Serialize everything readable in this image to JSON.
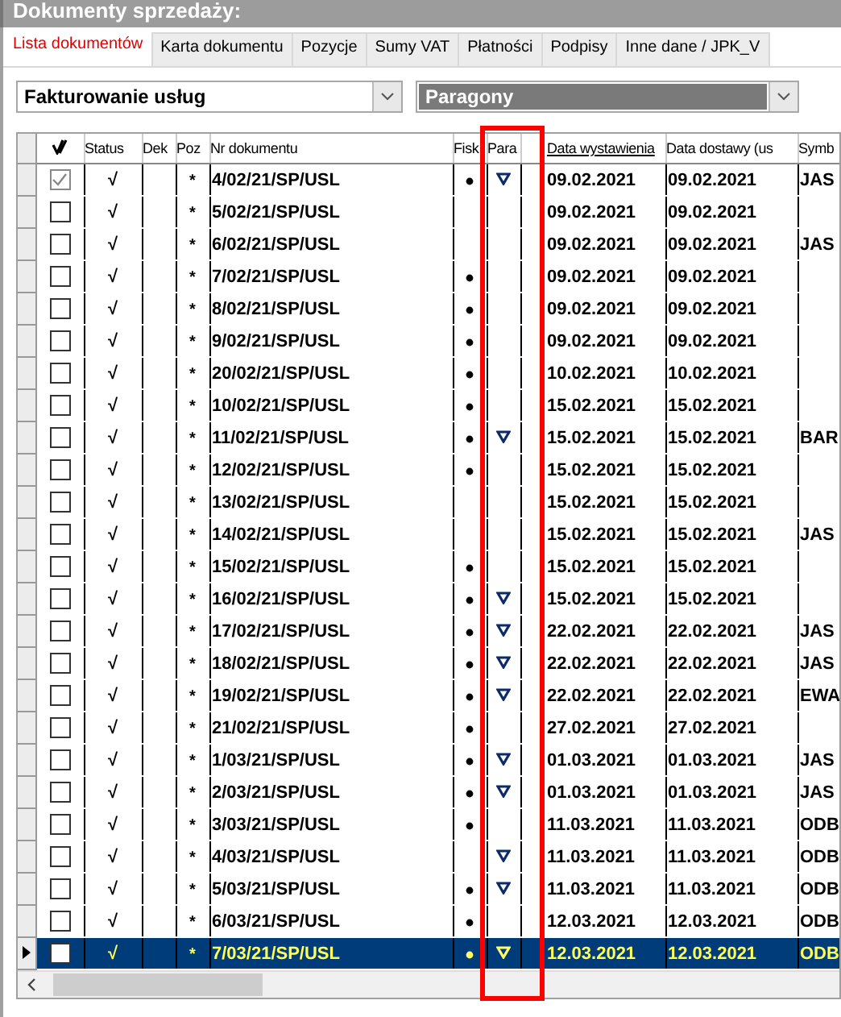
{
  "window": {
    "title": "Dokumenty sprzedaży:"
  },
  "tabs": [
    {
      "label": "Lista dokumentów",
      "selected": true
    },
    {
      "label": "Karta dokumentu",
      "selected": false
    },
    {
      "label": "Pozycje",
      "selected": false
    },
    {
      "label": "Sumy VAT",
      "selected": false
    },
    {
      "label": "Płatności",
      "selected": false
    },
    {
      "label": "Podpisy",
      "selected": false
    },
    {
      "label": "Inne dane / JPK_V",
      "selected": false
    }
  ],
  "filters": [
    {
      "value": "Fakturowanie usług",
      "highlighted": false
    },
    {
      "value": "Paragony",
      "highlighted": true
    }
  ],
  "table": {
    "columns": [
      {
        "kind": "check"
      },
      {
        "kind": "text",
        "label": "Status",
        "sorted": false
      },
      {
        "kind": "text",
        "label": "Dek",
        "sorted": false
      },
      {
        "kind": "text",
        "label": "Poz",
        "sorted": false
      },
      {
        "kind": "text",
        "label": "Nr dokumentu",
        "sorted": false
      },
      {
        "kind": "text",
        "label": "Fisk",
        "sorted": false
      },
      {
        "kind": "text",
        "label": "Para",
        "sorted": false
      },
      {
        "kind": "text",
        "label": "Data wystawienia",
        "sorted": true
      },
      {
        "kind": "text",
        "label": "Data dostawy (us",
        "sorted": false
      },
      {
        "kind": "text",
        "label": "Symb",
        "sorted": false
      }
    ],
    "rows": [
      {
        "checked": true,
        "status": "√",
        "poz": "*",
        "number": "4/02/21/SP/USL",
        "fiscal": true,
        "receipt": true,
        "issued": "09.02.2021",
        "delivered": "09.02.2021",
        "symbol": "JAS",
        "selected": false
      },
      {
        "checked": false,
        "status": "√",
        "poz": "*",
        "number": "5/02/21/SP/USL",
        "fiscal": false,
        "receipt": false,
        "issued": "09.02.2021",
        "delivered": "09.02.2021",
        "selected": false
      },
      {
        "checked": false,
        "status": "√",
        "poz": "*",
        "number": "6/02/21/SP/USL",
        "fiscal": false,
        "receipt": false,
        "issued": "09.02.2021",
        "delivered": "09.02.2021",
        "symbol": "JAS",
        "selected": false
      },
      {
        "checked": false,
        "status": "√",
        "poz": "*",
        "number": "7/02/21/SP/USL",
        "fiscal": true,
        "receipt": false,
        "issued": "09.02.2021",
        "delivered": "09.02.2021",
        "selected": false
      },
      {
        "checked": false,
        "status": "√",
        "poz": "*",
        "number": "8/02/21/SP/USL",
        "fiscal": true,
        "receipt": false,
        "issued": "09.02.2021",
        "delivered": "09.02.2021",
        "selected": false
      },
      {
        "checked": false,
        "status": "√",
        "poz": "*",
        "number": "9/02/21/SP/USL",
        "fiscal": true,
        "receipt": false,
        "issued": "09.02.2021",
        "delivered": "09.02.2021",
        "selected": false
      },
      {
        "checked": false,
        "status": "√",
        "poz": "*",
        "number": "20/02/21/SP/USL",
        "fiscal": true,
        "receipt": false,
        "issued": "10.02.2021",
        "delivered": "10.02.2021",
        "selected": false
      },
      {
        "checked": false,
        "status": "√",
        "poz": "*",
        "number": "10/02/21/SP/USL",
        "fiscal": true,
        "receipt": false,
        "issued": "15.02.2021",
        "delivered": "15.02.2021",
        "selected": false
      },
      {
        "checked": false,
        "status": "√",
        "poz": "*",
        "number": "11/02/21/SP/USL",
        "fiscal": true,
        "receipt": true,
        "issued": "15.02.2021",
        "delivered": "15.02.2021",
        "symbol": "BAR",
        "selected": false
      },
      {
        "checked": false,
        "status": "√",
        "poz": "*",
        "number": "12/02/21/SP/USL",
        "fiscal": true,
        "receipt": false,
        "issued": "15.02.2021",
        "delivered": "15.02.2021",
        "selected": false
      },
      {
        "checked": false,
        "status": "√",
        "poz": "*",
        "number": "13/02/21/SP/USL",
        "fiscal": false,
        "receipt": false,
        "issued": "15.02.2021",
        "delivered": "15.02.2021",
        "selected": false
      },
      {
        "checked": false,
        "status": "√",
        "poz": "*",
        "number": "14/02/21/SP/USL",
        "fiscal": false,
        "receipt": false,
        "issued": "15.02.2021",
        "delivered": "15.02.2021",
        "symbol": "JAS",
        "selected": false
      },
      {
        "checked": false,
        "status": "√",
        "poz": "*",
        "number": "15/02/21/SP/USL",
        "fiscal": true,
        "receipt": false,
        "issued": "15.02.2021",
        "delivered": "15.02.2021",
        "selected": false
      },
      {
        "checked": false,
        "status": "√",
        "poz": "*",
        "number": "16/02/21/SP/USL",
        "fiscal": true,
        "receipt": true,
        "issued": "15.02.2021",
        "delivered": "15.02.2021",
        "selected": false
      },
      {
        "checked": false,
        "status": "√",
        "poz": "*",
        "number": "17/02/21/SP/USL",
        "fiscal": true,
        "receipt": true,
        "issued": "22.02.2021",
        "delivered": "22.02.2021",
        "symbol": "JAS",
        "selected": false
      },
      {
        "checked": false,
        "status": "√",
        "poz": "*",
        "number": "18/02/21/SP/USL",
        "fiscal": true,
        "receipt": true,
        "issued": "22.02.2021",
        "delivered": "22.02.2021",
        "symbol": "JAS",
        "selected": false
      },
      {
        "checked": false,
        "status": "√",
        "poz": "*",
        "number": "19/02/21/SP/USL",
        "fiscal": true,
        "receipt": true,
        "issued": "22.02.2021",
        "delivered": "22.02.2021",
        "symbol": "EWA",
        "selected": false
      },
      {
        "checked": false,
        "status": "√",
        "poz": "*",
        "number": "21/02/21/SP/USL",
        "fiscal": true,
        "receipt": false,
        "issued": "27.02.2021",
        "delivered": "27.02.2021",
        "selected": false
      },
      {
        "checked": false,
        "status": "√",
        "poz": "*",
        "number": "1/03/21/SP/USL",
        "fiscal": true,
        "receipt": true,
        "issued": "01.03.2021",
        "delivered": "01.03.2021",
        "symbol": "JAS",
        "selected": false
      },
      {
        "checked": false,
        "status": "√",
        "poz": "*",
        "number": "2/03/21/SP/USL",
        "fiscal": true,
        "receipt": true,
        "issued": "01.03.2021",
        "delivered": "01.03.2021",
        "symbol": "JAS",
        "selected": false
      },
      {
        "checked": false,
        "status": "√",
        "poz": "*",
        "number": "3/03/21/SP/USL",
        "fiscal": true,
        "receipt": false,
        "issued": "11.03.2021",
        "delivered": "11.03.2021",
        "symbol": "ODB",
        "selected": false
      },
      {
        "checked": false,
        "status": "√",
        "poz": "*",
        "number": "4/03/21/SP/USL",
        "fiscal": false,
        "receipt": true,
        "issued": "11.03.2021",
        "delivered": "11.03.2021",
        "symbol": "ODB",
        "selected": false
      },
      {
        "checked": false,
        "status": "√",
        "poz": "*",
        "number": "5/03/21/SP/USL",
        "fiscal": true,
        "receipt": true,
        "issued": "11.03.2021",
        "delivered": "11.03.2021",
        "symbol": "ODB",
        "selected": false
      },
      {
        "checked": false,
        "status": "√",
        "poz": "*",
        "number": "6/03/21/SP/USL",
        "fiscal": true,
        "receipt": false,
        "issued": "12.03.2021",
        "delivered": "12.03.2021",
        "symbol": "ODB",
        "selected": false
      },
      {
        "checked": false,
        "status": "√",
        "poz": "*",
        "number": "7/03/21/SP/USL",
        "fiscal": true,
        "receipt": true,
        "issued": "12.03.2021",
        "delivered": "12.03.2021",
        "symbol": "ODB",
        "selected": true
      }
    ]
  },
  "annotation": {
    "color": "#ff0000"
  }
}
